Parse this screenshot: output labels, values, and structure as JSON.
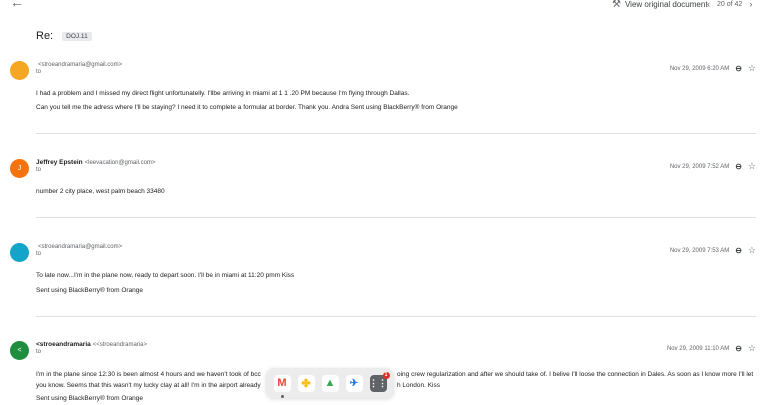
{
  "header": {
    "back_icon": "arrow-left-icon",
    "view_original": "View original document",
    "view_icon": "gavel-icon",
    "pager": "20 of 42",
    "prev": "‹",
    "next": "›"
  },
  "subject": {
    "prefix": "Re:",
    "label": "DOJ.11"
  },
  "messages": [
    {
      "avatar_letter": "",
      "avatar_color": "#f5a623",
      "name": "",
      "email": "<stroeandramaria@gmail.com>",
      "to": "to",
      "date": "Nov 29, 2009 6:20 AM",
      "lines": [
        "I had a problem and I missed my direct flight unfortunatelly. I'llbe arriving in miami at 1 1 .20 PM because I'm flying through Dallas.",
        "Can you tell me the adress where I'll be staying? I need it to complete a formular at border. Thank you. Andra Sent using BlackBerry® from Orange"
      ]
    },
    {
      "avatar_letter": "J",
      "avatar_color": "#f4730f",
      "name": "Jeffrey Epstein",
      "email": "<leevacation@gmail.com>",
      "to": "to",
      "date": "Nov 29, 2009 7:52 AM",
      "lines": [
        "number 2 city place, west palm beach 33480"
      ]
    },
    {
      "avatar_letter": "",
      "avatar_color": "#12a4c9",
      "name": "",
      "email": "<stroeandramaria@gmail.com>",
      "to": "to",
      "date": "Nov 29, 2009 7:53 AM",
      "lines": [
        "To late now...I'm in the plane now, ready to depart soon. I'll be in miami at 11:20 pmm Kiss",
        "Sent using BlackBerry® from Orange"
      ]
    },
    {
      "avatar_letter": "<",
      "avatar_color": "#1e8e3e",
      "name": "<stroeandramaria",
      "email": "<<stroeandramaria>",
      "to": "to",
      "date": "Nov 29, 2009 11:10 AM",
      "lines": [
        "I'm in the plane since 12:30 is been almost 4 hours and we haven't took of bcc",
        "you know. Seems that this wasn't my lucky clay at all! I'm in the airport already",
        "Sent using BlackBerry® from Orange"
      ],
      "lines_right": [
        "oing crew regularization and after we should take of. I belive I'll loose the connection in Dales. As soon as I know more I'll let",
        "h London. Kiss"
      ]
    }
  ],
  "dock": {
    "apps": [
      "gmail-icon",
      "photos-icon",
      "drive-icon",
      "flights-icon",
      "app-launcher-icon"
    ],
    "badge": "1"
  }
}
